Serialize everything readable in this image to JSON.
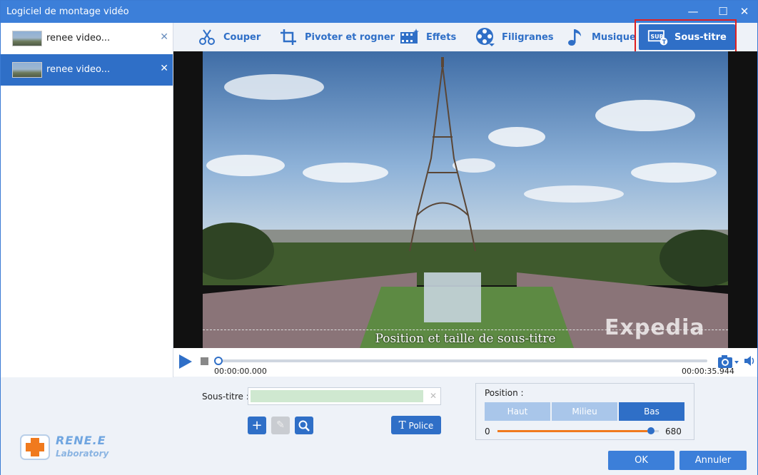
{
  "window": {
    "title": "Logiciel de montage vidéo",
    "minimize": "—",
    "maximize": "☐",
    "close": "✕"
  },
  "sidebar": {
    "items": [
      {
        "name": "renee video...",
        "close": "✕",
        "active": false
      },
      {
        "name": "renee video...",
        "close": "✕",
        "active": true
      }
    ]
  },
  "toolbar": {
    "tools": [
      {
        "label": "Couper",
        "icon": "scissors-icon"
      },
      {
        "label": "Pivoter et rogner",
        "icon": "crop-rotate-icon"
      },
      {
        "label": "Effets",
        "icon": "effects-film-icon"
      },
      {
        "label": "Filigranes",
        "icon": "watermark-reel-icon"
      },
      {
        "label": "Musique",
        "icon": "music-note-icon"
      },
      {
        "label": "Sous-titre",
        "icon": "subtitle-icon",
        "active": true
      }
    ]
  },
  "video": {
    "subtitle_text": "Position et taille de sous-titre",
    "watermark": "Expedia"
  },
  "playback": {
    "current_time": "00:00:00.000",
    "total_time": "00:00:35.944",
    "progress": 0
  },
  "subtitle_form": {
    "label": "Sous-titre :",
    "clear": "✕",
    "add": "+",
    "edit": "✎",
    "search": "⌕",
    "police_icon": "T",
    "police_label": "Police"
  },
  "position": {
    "label": "Position :",
    "options": [
      "Haut",
      "Milieu",
      "Bas"
    ],
    "selected": "Bas",
    "min": "0",
    "max": "680",
    "value": 680
  },
  "footer": {
    "ok": "OK",
    "cancel": "Annuler",
    "logo_line1": "RENE.E",
    "logo_line2": "Laboratory"
  },
  "colors": {
    "accent": "#2f6fc7",
    "titlebar": "#3c7fd9",
    "highlight": "#e02020",
    "slider_fill": "#f07a1e"
  }
}
